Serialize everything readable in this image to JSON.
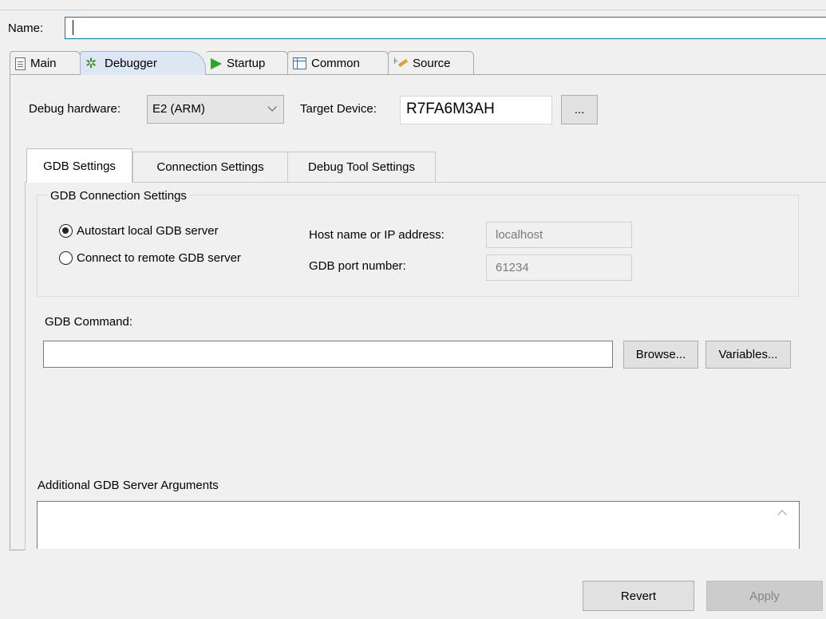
{
  "name": {
    "label": "Name:",
    "value": ""
  },
  "tabs": [
    {
      "label": "Main",
      "icon": "document-icon"
    },
    {
      "label": "Debugger",
      "icon": "bug-icon",
      "active": true
    },
    {
      "label": "Startup",
      "icon": "play-icon"
    },
    {
      "label": "Common",
      "icon": "table-icon"
    },
    {
      "label": "Source",
      "icon": "source-lookup-icon"
    }
  ],
  "debugger": {
    "hardware_label": "Debug hardware:",
    "hardware_value": "E2 (ARM)",
    "target_label": "Target Device:",
    "target_value": "R7FA6M3AH",
    "browse_target_label": "..."
  },
  "subtabs": [
    {
      "label": "GDB Settings",
      "active": true
    },
    {
      "label": "Connection Settings"
    },
    {
      "label": "Debug Tool Settings"
    }
  ],
  "gdb": {
    "group_title": "GDB Connection Settings",
    "radio_autostart": "Autostart local GDB server",
    "radio_remote": "Connect to remote GDB server",
    "selected": "autostart",
    "host_label": "Host name or IP address:",
    "host_value": "localhost",
    "port_label": "GDB port number:",
    "port_value": "61234",
    "command_label": "GDB Command:",
    "command_value": "",
    "browse_label": "Browse...",
    "variables_label": "Variables...",
    "args_label": "Additional GDB Server Arguments",
    "args_value": ""
  },
  "footer": {
    "revert_label": "Revert",
    "apply_label": "Apply"
  },
  "colors": {
    "focus_border": "#0078d7",
    "active_tab_bg": "#dce7f3",
    "window_bg": "#f0f0f0"
  }
}
